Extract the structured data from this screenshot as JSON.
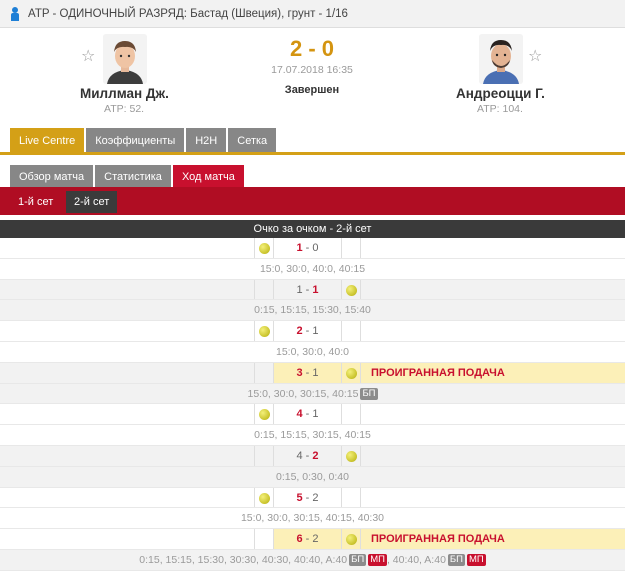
{
  "header": {
    "tournament": "ATP - ОДИНОЧНЫЙ РАЗРЯД: Бастад (Швеция), грунт - 1/16"
  },
  "match": {
    "player1": {
      "name": "Миллман Дж.",
      "rank": "ATP: 52."
    },
    "player2": {
      "name": "Андреоцци Г.",
      "rank": "ATP: 104."
    },
    "score": "2 - 0",
    "date": "17.07.2018 16:35",
    "status": "Завершен"
  },
  "tabs_main": [
    "Live Centre",
    "Коэффициенты",
    "H2H",
    "Сетка"
  ],
  "tabs_sub": [
    "Обзор матча",
    "Статистика",
    "Ход матча"
  ],
  "set_tabs": [
    "1-й сет",
    "2-й сет"
  ],
  "pbp": {
    "title": "Очко за очком - 2-й сет",
    "games": [
      {
        "s1": "1",
        "sep": " - ",
        "s2": "0",
        "points": "15:0, 30:0, 40:0, 40:15"
      },
      {
        "s1": "1",
        "sep": " - ",
        "s2": "1",
        "points": "0:15, 15:15, 15:30, 15:40"
      },
      {
        "s1": "2",
        "sep": " - ",
        "s2": "1",
        "points": "15:0, 30:0, 40:0"
      },
      {
        "s1": "3",
        "sep": " - ",
        "s2": "1",
        "lost": "ПРОИГРАННАЯ ПОДАЧА",
        "points": "15:0, 30:0, 30:15, 40:15",
        "badge1": "БП"
      },
      {
        "s1": "4",
        "sep": " - ",
        "s2": "1",
        "points": "0:15, 15:15, 30:15, 40:15"
      },
      {
        "s1": "4",
        "sep": " - ",
        "s2": "2",
        "points": "0:15, 0:30, 0:40"
      },
      {
        "s1": "5",
        "sep": " - ",
        "s2": "2",
        "points": "15:0, 30:0, 30:15, 40:15, 40:30"
      },
      {
        "s1": "6",
        "sep": " - ",
        "s2": "2",
        "lost": "ПРОИГРАННАЯ ПОДАЧА",
        "points_a": "0:15, 15:15, 15:30, 30:30, 40:30, 40:40, A:40",
        "badge_a1": "БП",
        "badge_a2": "МП",
        "points_b": ", 40:40, A:40",
        "badge_b1": "БП",
        "badge_b2": "МП"
      }
    ]
  },
  "colors": {
    "accent_gold": "#d4a017",
    "accent_red": "#c8102e",
    "header_dark": "#3a3a3a"
  }
}
